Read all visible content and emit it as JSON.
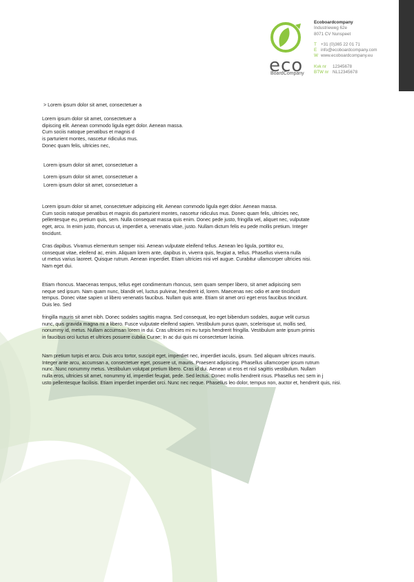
{
  "header": {
    "logo_word": "eco",
    "logo_sub": "BoardCompany",
    "company": "Ecoboardcompany",
    "address1": "Industrieweg 62e",
    "address2": "8071 CV Nunspeet",
    "phone_key": "T",
    "phone": "+31 (0)365 22 01 71",
    "email_key": "E",
    "email": "info@ecoboardcompany.com",
    "web_key": "W",
    "web": "www.ecoboardcompany.eu",
    "kvk_key": "Kvk nr",
    "kvk": "12345678",
    "btw_key": "BTW nr",
    "btw": "NL12345678"
  },
  "colors": {
    "accent": "#8dc63f",
    "dark_tab": "#333333"
  },
  "body": {
    "subject": "> Lorem ipsum dolor sit amet, consectetuer a",
    "address_lines": [
      "Lorem ipsum dolor sit amet, consectetuer a",
      "dipiscing elit. Aenean commodo ligula eget dolor. Aenean massa.",
      "Cum sociis natoque penatibus et magnis d",
      "is parturient montes, nascetur ridiculus mus.",
      "Donec quam felis, ultricies nec,"
    ],
    "ref1": "Lorem ipsum dolor sit amet, consectetuer a",
    "ref2": "Lorem ipsum dolor sit amet, consectetuer a",
    "ref3": "Lorem ipsum dolor sit amet, consectetuer a",
    "para1": [
      "Lorem ipsum dolor sit amet, consectetuer adipiscing elit. Aenean commodo ligula eget dolor. Aenean massa.",
      "Cum sociis natoque penatibus et magnis dis parturient montes, nascetur ridiculus mus. Donec quam felis, ultricies nec,",
      "pellentesque eu, pretium quis, sem. Nulla consequat massa quis enim. Donec pede justo, fringilla vel, aliquet nec, vulputate",
      " eget, arcu. In enim justo, rhoncus ut, imperdiet a, venenatis vitae, justo. Nullam dictum felis eu pede mollis pretium. Integer",
      "tincidunt."
    ],
    "para2": [
      "Cras dapibus. Vivamus elementum semper nisi. Aenean vulputate eleifend tellus. Aenean leo ligula, porttitor eu,",
      "consequat vitae, eleifend ac, enim. Aliquam lorem ante, dapibus in, viverra quis, feugiat a, tellus. Phasellus viverra nulla",
      "ut metus varius laoreet. Quisque rutrum. Aenean imperdiet. Etiam ultricies nisi vel augue. Curabitur ullamcorper ultricies nisi.",
      "Nam eget dui."
    ],
    "para3": [
      "Etiam rhoncus. Maecenas tempus, tellus eget condimentum rhoncus, sem quam semper libero, sit amet adipiscing sem",
      "neque sed ipsum. Nam quam nunc, blandit vel, luctus pulvinar, hendrerit id, lorem. Maecenas nec odio et ante tincidunt",
      "tempus. Donec vitae sapien ut libero venenatis faucibus. Nullam quis ante. Etiam sit amet orci eget eros faucibus tincidunt.",
      "Duis leo. Sed"
    ],
    "para4": [
      "fringilla mauris sit amet nibh. Donec sodales sagittis magna. Sed consequat, leo eget bibendum sodales, augue velit cursus",
      "nunc, quis gravida magna mi a libero. Fusce vulputate eleifend sapien. Vestibulum purus quam, scelerisque ut, mollis sed,",
      "nonummy id, metus. Nullam accumsan lorem in dui. Cras ultricies mi eu turpis hendrerit fringilla. Vestibulum ante ipsum primis",
      "in faucibus orci luctus et ultrices posuere cubilia Curae; In ac dui quis mi consectetuer lacinia."
    ],
    "para5": [
      "Nam pretium turpis et arcu. Duis arcu tortor, suscipit eget, imperdiet nec, imperdiet iaculis, ipsum. Sed aliquam ultrices mauris.",
      "Integer ante arcu, accumsan a, consectetuer eget, posuere ut, mauris. Praesent adipiscing. Phasellus ullamcorper ipsum rutrum",
      "nunc. Nunc nonummy metus. Vestibulum volutpat pretium libero. Cras id dui. Aenean ut eros et nisl sagittis vestibulum. Nullam",
      "nulla eros, ultricies sit amet, nonummy id, imperdiet feugiat, pede. Sed lectus. Donec mollis hendrerit risus. Phasellus nec sem in j",
      "usto pellentesque facilisis. Etiam imperdiet imperdiet orci. Nunc nec neque. Phasellus leo dolor, tempus non, auctor et, hendrerit quis, nisi."
    ]
  }
}
